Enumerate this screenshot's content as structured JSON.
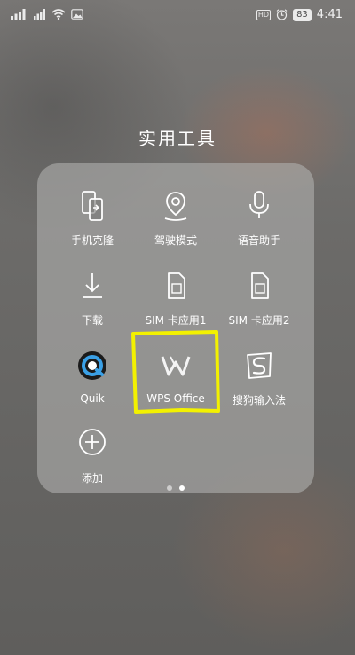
{
  "status_bar": {
    "battery": "83",
    "time": "4:41",
    "hd_label": "HD"
  },
  "folder": {
    "title": "实用工具",
    "apps": [
      {
        "label": "手机克隆",
        "icon": "phone-clone-icon"
      },
      {
        "label": "驾驶模式",
        "icon": "driving-mode-icon"
      },
      {
        "label": "语音助手",
        "icon": "microphone-icon"
      },
      {
        "label": "下载",
        "icon": "download-icon"
      },
      {
        "label": "SIM 卡应用1",
        "icon": "sim-card-icon"
      },
      {
        "label": "SIM 卡应用2",
        "icon": "sim-card-icon"
      },
      {
        "label": "Quik",
        "icon": "quik-icon"
      },
      {
        "label": "WPS Office",
        "icon": "wps-office-icon"
      },
      {
        "label": "搜狗输入法",
        "icon": "sogou-input-icon"
      },
      {
        "label": "添加",
        "icon": "add-icon"
      }
    ],
    "page_indicator": {
      "pages": 2,
      "current": 2
    }
  },
  "colors": {
    "highlight": "#f3f100",
    "panel": "#afafad",
    "text": "#ffffff"
  }
}
